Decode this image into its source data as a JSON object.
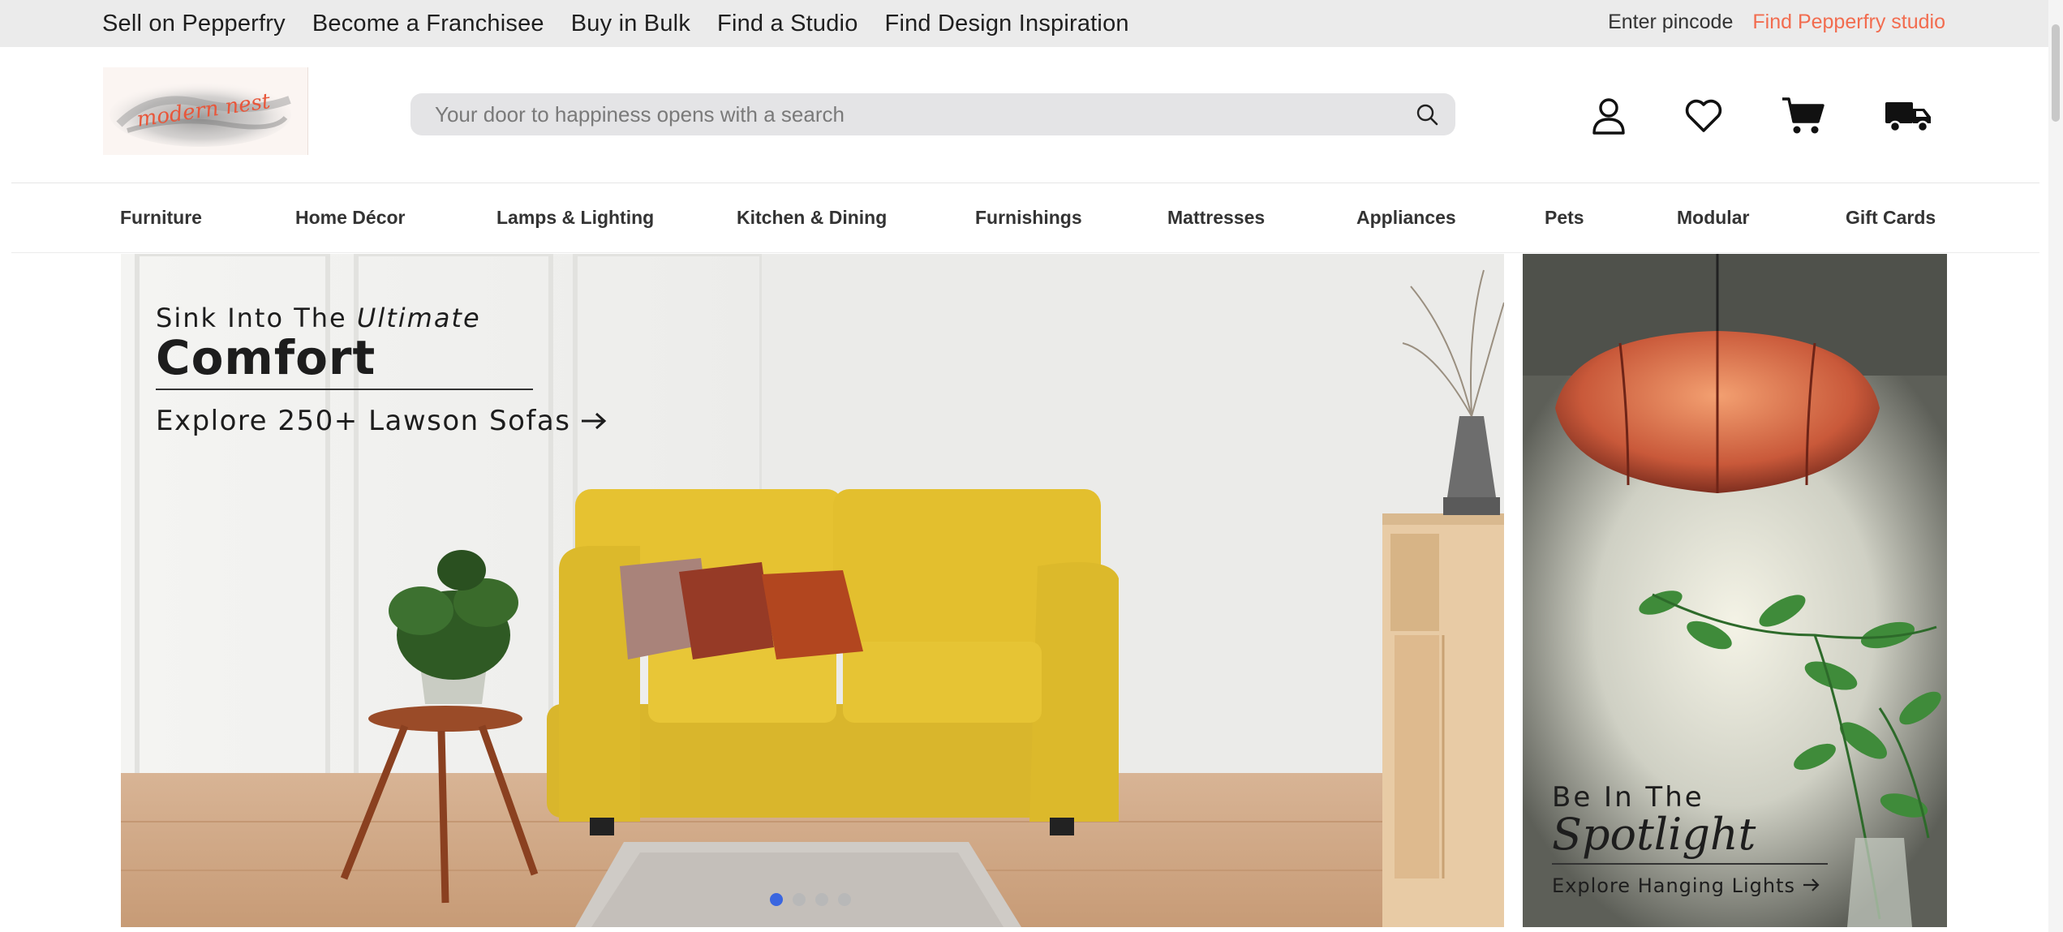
{
  "top_bar": {
    "links": [
      "Sell on Pepperfry",
      "Become a Franchisee",
      "Buy in Bulk",
      "Find a Studio",
      "Find Design Inspiration"
    ],
    "pincode_label": "Enter pincode",
    "studio_link": "Find Pepperfry studio",
    "studio_link_color": "#f26c4f"
  },
  "header": {
    "logo_text": "modern nest",
    "logo_color": "#e8563a",
    "search_placeholder": "Your door to happiness opens with a search",
    "icons": [
      "user-icon",
      "heart-icon",
      "cart-icon",
      "truck-icon"
    ]
  },
  "categories": [
    "Furniture",
    "Home Décor",
    "Lamps & Lighting",
    "Kitchen & Dining",
    "Furnishings",
    "Mattresses",
    "Appliances",
    "Pets",
    "Modular",
    "Gift Cards"
  ],
  "hero": {
    "line1_prefix": "Sink Into The ",
    "line1_emphasis": "Ultimate",
    "line2": "Comfort",
    "cta": "Explore 250+ Lawson Sofas",
    "slide_count": 4,
    "active_slide": 1
  },
  "promo": {
    "line1": "Be In The",
    "line2": "Spotlight",
    "cta": "Explore Hanging Lights"
  }
}
